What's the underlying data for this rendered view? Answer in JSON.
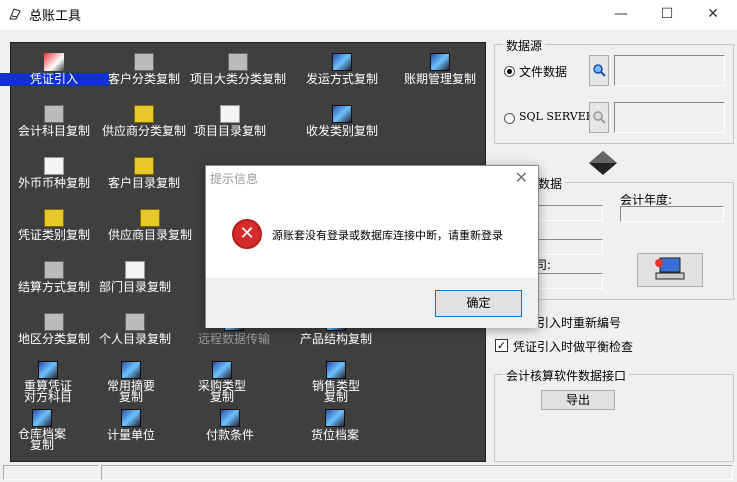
{
  "window": {
    "title": "总账工具",
    "min_glyph": "—",
    "max_glyph": "☐",
    "close_glyph": "✕"
  },
  "tools": [
    {
      "id": "voucher-import",
      "label": "凭证引入",
      "icon": "pen-icon",
      "selected": true
    },
    {
      "id": "customer-category-copy",
      "label": "客户分类复制",
      "icon": "printer-icon"
    },
    {
      "id": "project-category-copy",
      "label": "项目大类分类复制",
      "icon": "car-icon"
    },
    {
      "id": "shipping-method-copy",
      "label": "发运方式复制",
      "icon": "image-icon"
    },
    {
      "id": "period-management-copy",
      "label": "账期管理复制",
      "icon": "image-icon"
    },
    {
      "id": "account-subject-copy",
      "label": "会计科目复制",
      "icon": "printer-icon"
    },
    {
      "id": "supplier-category-copy",
      "label": "供应商分类复制",
      "icon": "diamond-icon"
    },
    {
      "id": "project-directory-copy",
      "label": "项目目录复制",
      "icon": "document-icon"
    },
    {
      "id": "dispatch-category-copy",
      "label": "收发类别复制",
      "icon": "image-icon"
    },
    {
      "id": "foreign-currency-copy",
      "label": "外币币种复制",
      "icon": "computer-icon"
    },
    {
      "id": "customer-directory-copy",
      "label": "客户目录复制",
      "icon": "folder-icon"
    },
    {
      "id": "voucher-type-copy",
      "label": "凭证类别复制",
      "icon": "folder-icon"
    },
    {
      "id": "supplier-directory-copy",
      "label": "供应商目录复制",
      "icon": "folder-icon"
    },
    {
      "id": "settlement-method-copy",
      "label": "结算方式复制",
      "icon": "car-icon"
    },
    {
      "id": "department-directory-copy",
      "label": "部门目录复制",
      "icon": "book-icon"
    },
    {
      "id": "region-category-copy",
      "label": "地区分类复制",
      "icon": "car-icon"
    },
    {
      "id": "personal-directory-copy",
      "label": "个人目录复制",
      "icon": "card-icon"
    },
    {
      "id": "remote-data-transfer",
      "label": "远程数据传输",
      "icon": "image-icon",
      "disabled": true
    },
    {
      "id": "product-structure-copy",
      "label": "产品结构复制",
      "icon": "image-icon"
    },
    {
      "id": "recalc-voucher-subject",
      "label": "重算凭证对方科目",
      "icon": "image-icon"
    },
    {
      "id": "common-summary-copy",
      "label": "常用摘要复制",
      "icon": "image-icon"
    },
    {
      "id": "purchase-type-copy",
      "label": "采购类型复制",
      "icon": "image-icon"
    },
    {
      "id": "sales-type-copy",
      "label": "销售类型复制",
      "icon": "image-icon"
    },
    {
      "id": "warehouse-archive-copy",
      "label": "仓库档案复制",
      "icon": "image-icon"
    },
    {
      "id": "unit-of-measure",
      "label": "计量单位",
      "icon": "image-icon"
    },
    {
      "id": "payment-terms",
      "label": "付款条件",
      "icon": "image-icon"
    },
    {
      "id": "location-archive",
      "label": "货位档案",
      "icon": "image-icon"
    }
  ],
  "datasource": {
    "legend": "数据源",
    "file_label": "文件数据",
    "sql_label": "SQL SERVER",
    "file_selected": true,
    "file_path": "",
    "sql_path": ""
  },
  "data_panel": {
    "legend_tail": "数据",
    "fiscal_year_label": "会计年度:",
    "value_tail": "司:",
    "fiscal_year": ""
  },
  "options": {
    "renumber_partial": "引入时重新编号",
    "balance_check_label": "凭证引入时做平衡检查",
    "balance_check": true,
    "check_glyph": "✓"
  },
  "export_group": {
    "legend": "会计核算软件数据接口",
    "export_label": "导出"
  },
  "dialog": {
    "title": "提示信息",
    "close_glyph": "✕",
    "error_glyph": "✕",
    "message": "源账套没有登录或数据库连接中断，请重新登录",
    "ok_label": "确定"
  }
}
